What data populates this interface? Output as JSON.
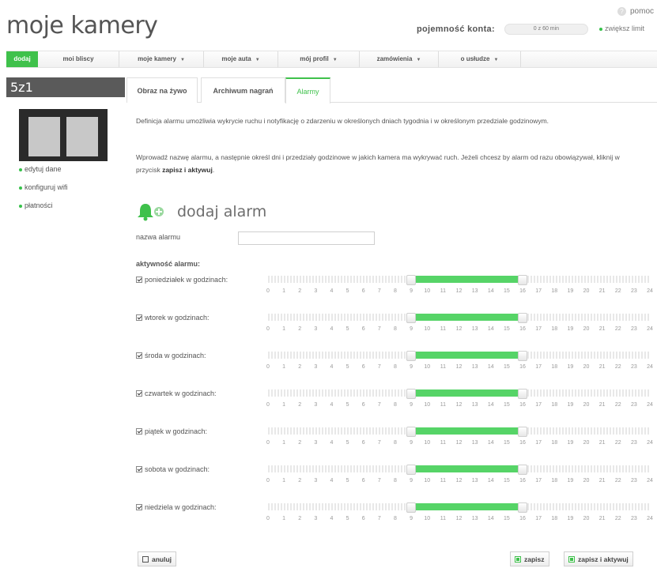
{
  "header": {
    "title": "moje kamery",
    "help_label": "pomoc",
    "capacity_label": "pojemność konta:",
    "capacity_value": "0 z 60 min",
    "increase_limit": "zwiększ limit"
  },
  "nav": {
    "items": [
      {
        "label": "dodaj",
        "dropdown": false,
        "active": true
      },
      {
        "label": "moi bliscy",
        "dropdown": false,
        "active": false
      },
      {
        "label": "moje kamery",
        "dropdown": true,
        "active": false
      },
      {
        "label": "moje auta",
        "dropdown": true,
        "active": false
      },
      {
        "label": "mój profil",
        "dropdown": true,
        "active": false
      },
      {
        "label": "zamówienia",
        "dropdown": true,
        "active": false
      },
      {
        "label": "o usłudze",
        "dropdown": true,
        "active": false
      }
    ]
  },
  "sidebar": {
    "device_title": "5z1",
    "links": [
      "edytuj dane",
      "konfiguruj wifi",
      "płatności"
    ]
  },
  "tabs": [
    {
      "label": "Obraz na żywo",
      "active": false
    },
    {
      "label": "Archiwum nagrań",
      "active": false
    },
    {
      "label": "Alarmy",
      "active": true
    }
  ],
  "content": {
    "desc1": "Definicja alarmu umożliwia wykrycie ruchu i notyfikację o zdarzeniu w określonych dniach tygodnia i w określonym przedziale godzinowym.",
    "desc2_start": "Wprowadź nazwę alarmu, a następnie określ dni i przedziały godzinowe w jakich kamera ma wykrywać ruch. Jeżeli chcesz by alarm od razu obowiązywał, kliknij w przycisk ",
    "desc2_bold": "zapisz i aktywuj",
    "desc2_end": ".",
    "add_alarm_title": "dodaj alarm",
    "name_label": "nazwa alarmu",
    "name_value": "",
    "activity_label": "aktywność alarmu:",
    "hour_scale": [
      "0",
      "1",
      "2",
      "3",
      "4",
      "5",
      "6",
      "7",
      "8",
      "9",
      "10",
      "11",
      "12",
      "13",
      "14",
      "15",
      "16",
      "17",
      "18",
      "19",
      "20",
      "21",
      "22",
      "23",
      "24"
    ],
    "days": [
      {
        "label": "poniedziałek w godzinach:",
        "checked": true,
        "from": 9,
        "to": 16
      },
      {
        "label": "wtorek w godzinach:",
        "checked": true,
        "from": 9,
        "to": 16
      },
      {
        "label": "środa w godzinach:",
        "checked": true,
        "from": 9,
        "to": 16
      },
      {
        "label": "czwartek w godzinach:",
        "checked": true,
        "from": 9,
        "to": 16
      },
      {
        "label": "piątek w godzinach:",
        "checked": true,
        "from": 9,
        "to": 16
      },
      {
        "label": "sobota w godzinach:",
        "checked": true,
        "from": 9,
        "to": 16
      },
      {
        "label": "niedziela w godzinach:",
        "checked": true,
        "from": 9,
        "to": 16
      }
    ]
  },
  "buttons": {
    "cancel": "anuluj",
    "save": "zapisz",
    "save_activate": "zapisz i aktywuj"
  },
  "colors": {
    "accent": "#3fc14b",
    "range": "#56d467",
    "sidebar_header": "#5a5a5a"
  }
}
